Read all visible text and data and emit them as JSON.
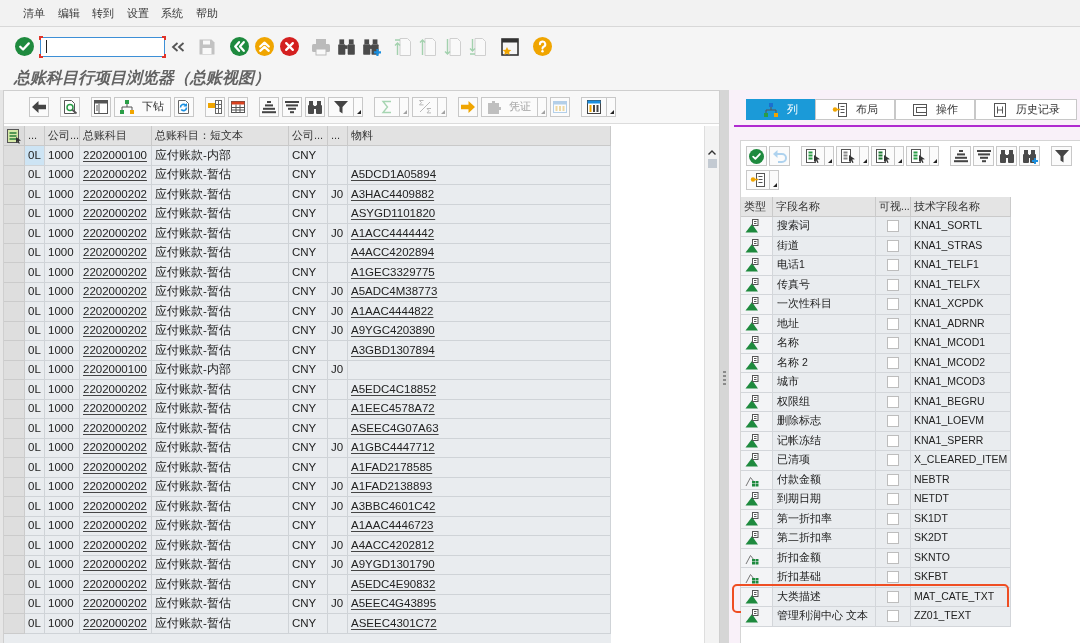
{
  "menu_bar": [
    "清单",
    "编辑",
    "转到",
    "设置",
    "系统",
    "帮助"
  ],
  "toolbar": [
    [
      {
        "kind": "enter",
        "disabled": false
      },
      {
        "kind": "command_field",
        "focused": true
      }
    ],
    [
      {
        "kind": "save",
        "disabled": true
      }
    ],
    [
      {
        "kind": "back",
        "disabled": false
      },
      {
        "kind": "exit",
        "disabled": false
      },
      {
        "kind": "cancel",
        "disabled": false
      }
    ],
    [
      {
        "kind": "print",
        "disabled": true
      },
      {
        "kind": "find",
        "disabled": false
      },
      {
        "kind": "find_next",
        "disabled": false
      }
    ],
    [
      {
        "kind": "first_page",
        "disabled": true
      },
      {
        "kind": "previous_page",
        "disabled": true
      },
      {
        "kind": "next_page",
        "disabled": true
      },
      {
        "kind": "last_page",
        "disabled": true
      }
    ],
    [
      {
        "kind": "new_session",
        "disabled": false
      }
    ],
    [
      {
        "kind": "help",
        "disabled": false
      }
    ]
  ],
  "title": "总账科目行项目浏览器（总账视图）",
  "grid_toolbar": [
    [
      {
        "kind": "back",
        "disabled": false,
        "dropdown": false
      }
    ],
    [
      {
        "kind": "detail",
        "disabled": false,
        "dropdown": false
      }
    ],
    [
      {
        "kind": "list_layout",
        "disabled": false,
        "dropdown": false
      },
      {
        "kind": "drilldown",
        "label": "下钻",
        "disabled": false,
        "dropdown": false
      },
      {
        "kind": "refresh",
        "disabled": false,
        "dropdown": false
      }
    ],
    [
      {
        "kind": "choose_layout",
        "disabled": false,
        "dropdown": false
      },
      {
        "kind": "spreadsheet",
        "disabled": false,
        "dropdown": false
      }
    ],
    [
      {
        "kind": "sort_ascending",
        "disabled": false,
        "dropdown": false
      },
      {
        "kind": "sort_descending",
        "disabled": false,
        "dropdown": false
      },
      {
        "kind": "find",
        "disabled": false,
        "dropdown": false
      },
      {
        "kind": "filter",
        "disabled": false,
        "dropdown": true
      }
    ],
    [
      {
        "kind": "sum",
        "disabled": true,
        "dropdown": true
      },
      {
        "kind": "subtotal",
        "disabled": true,
        "dropdown": true
      }
    ],
    [
      {
        "kind": "next",
        "disabled": false,
        "dropdown": false
      },
      {
        "kind": "document",
        "label": "凭证",
        "disabled": true,
        "dropdown": true
      },
      {
        "kind": "view",
        "disabled": true,
        "dropdown": false
      }
    ],
    [
      {
        "kind": "layout",
        "disabled": false,
        "dropdown": true
      }
    ]
  ],
  "table": {
    "columns": [
      "...",
      "公司...",
      "总账科目",
      "总账科目：短文本",
      "公司...",
      "...",
      "物料"
    ],
    "rows": [
      {
        "column_1": "0L",
        "column_2": "1000",
        "gl_account": "2202000100",
        "gl_short_text": "应付账款-内部",
        "column_5": "CNY",
        "focused": true
      },
      {
        "column_1": "0L",
        "column_2": "1000",
        "gl_account": "2202000202",
        "gl_short_text": "应付账款-暂估",
        "column_5": "CNY",
        "material": "A5DCD1A05894",
        "focused": false
      },
      {
        "column_1": "0L",
        "column_2": "1000",
        "gl_account": "2202000202",
        "gl_short_text": "应付账款-暂估",
        "column_5": "CNY",
        "column_6": "J0",
        "material": "A3HAC4409882",
        "focused": false
      },
      {
        "column_1": "0L",
        "column_2": "1000",
        "gl_account": "2202000202",
        "gl_short_text": "应付账款-暂估",
        "column_5": "CNY",
        "material": "ASYGD1101820",
        "focused": false
      },
      {
        "column_1": "0L",
        "column_2": "1000",
        "gl_account": "2202000202",
        "gl_short_text": "应付账款-暂估",
        "column_5": "CNY",
        "column_6": "J0",
        "material": "A1ACC4444442",
        "focused": false
      },
      {
        "column_1": "0L",
        "column_2": "1000",
        "gl_account": "2202000202",
        "gl_short_text": "应付账款-暂估",
        "column_5": "CNY",
        "material": "A4ACC4202894",
        "focused": false
      },
      {
        "column_1": "0L",
        "column_2": "1000",
        "gl_account": "2202000202",
        "gl_short_text": "应付账款-暂估",
        "column_5": "CNY",
        "material": "A1GEC3329775",
        "focused": false
      },
      {
        "column_1": "0L",
        "column_2": "1000",
        "gl_account": "2202000202",
        "gl_short_text": "应付账款-暂估",
        "column_5": "CNY",
        "column_6": "J0",
        "material": "A5ADC4M38773",
        "focused": false
      },
      {
        "column_1": "0L",
        "column_2": "1000",
        "gl_account": "2202000202",
        "gl_short_text": "应付账款-暂估",
        "column_5": "CNY",
        "column_6": "J0",
        "material": "A1AAC4444822",
        "focused": false
      },
      {
        "column_1": "0L",
        "column_2": "1000",
        "gl_account": "2202000202",
        "gl_short_text": "应付账款-暂估",
        "column_5": "CNY",
        "column_6": "J0",
        "material": "A9YGC4203890",
        "focused": false
      },
      {
        "column_1": "0L",
        "column_2": "1000",
        "gl_account": "2202000202",
        "gl_short_text": "应付账款-暂估",
        "column_5": "CNY",
        "material": "A3GBD1307894",
        "focused": false
      },
      {
        "column_1": "0L",
        "column_2": "1000",
        "gl_account": "2202000100",
        "gl_short_text": "应付账款-内部",
        "column_5": "CNY",
        "column_6": "J0",
        "focused": false
      },
      {
        "column_1": "0L",
        "column_2": "1000",
        "gl_account": "2202000202",
        "gl_short_text": "应付账款-暂估",
        "column_5": "CNY",
        "material": "A5EDC4C18852",
        "focused": false
      },
      {
        "column_1": "0L",
        "column_2": "1000",
        "gl_account": "2202000202",
        "gl_short_text": "应付账款-暂估",
        "column_5": "CNY",
        "material": "A1EEC4578A72",
        "focused": false
      },
      {
        "column_1": "0L",
        "column_2": "1000",
        "gl_account": "2202000202",
        "gl_short_text": "应付账款-暂估",
        "column_5": "CNY",
        "material": "ASEEC4G07A63",
        "focused": false
      },
      {
        "column_1": "0L",
        "column_2": "1000",
        "gl_account": "2202000202",
        "gl_short_text": "应付账款-暂估",
        "column_5": "CNY",
        "column_6": "J0",
        "material": "A1GBC4447712",
        "focused": false
      },
      {
        "column_1": "0L",
        "column_2": "1000",
        "gl_account": "2202000202",
        "gl_short_text": "应付账款-暂估",
        "column_5": "CNY",
        "material": "A1FAD2178585",
        "focused": false
      },
      {
        "column_1": "0L",
        "column_2": "1000",
        "gl_account": "2202000202",
        "gl_short_text": "应付账款-暂估",
        "column_5": "CNY",
        "column_6": "J0",
        "material": "A1FAD2138893",
        "focused": false
      },
      {
        "column_1": "0L",
        "column_2": "1000",
        "gl_account": "2202000202",
        "gl_short_text": "应付账款-暂估",
        "column_5": "CNY",
        "column_6": "J0",
        "material": "A3BBC4601C42",
        "focused": false
      },
      {
        "column_1": "0L",
        "column_2": "1000",
        "gl_account": "2202000202",
        "gl_short_text": "应付账款-暂估",
        "column_5": "CNY",
        "material": "A1AAC4446723",
        "focused": false
      },
      {
        "column_1": "0L",
        "column_2": "1000",
        "gl_account": "2202000202",
        "gl_short_text": "应付账款-暂估",
        "column_5": "CNY",
        "column_6": "J0",
        "material": "A4ACC4202812",
        "focused": false
      },
      {
        "column_1": "0L",
        "column_2": "1000",
        "gl_account": "2202000202",
        "gl_short_text": "应付账款-暂估",
        "column_5": "CNY",
        "column_6": "J0",
        "material": "A9YGD1301790",
        "focused": false
      },
      {
        "column_1": "0L",
        "column_2": "1000",
        "gl_account": "2202000202",
        "gl_short_text": "应付账款-暂估",
        "column_5": "CNY",
        "material": "A5EDC4E90832",
        "focused": false
      },
      {
        "column_1": "0L",
        "column_2": "1000",
        "gl_account": "2202000202",
        "gl_short_text": "应付账款-暂估",
        "column_5": "CNY",
        "column_6": "J0",
        "material": "A5EEC4G43895",
        "focused": false
      },
      {
        "column_1": "0L",
        "column_2": "1000",
        "gl_account": "2202000202",
        "gl_short_text": "应付账款-暂估",
        "column_5": "CNY",
        "material": "ASEEC4301C72",
        "focused": false
      }
    ]
  },
  "side_panel": {
    "tabs": [
      {
        "kind": "columns",
        "label": "列",
        "selected": true
      },
      {
        "kind": "layout",
        "label": "布局",
        "selected": false
      },
      {
        "kind": "operations",
        "label": "操作",
        "selected": false
      },
      {
        "kind": "history",
        "label": "历史记录",
        "selected": false
      }
    ],
    "toolbar": [
      [
        [
          {
            "kind": "confirm",
            "disabled": false,
            "dropdown": false
          },
          {
            "kind": "undo",
            "disabled": true,
            "dropdown": false
          }
        ],
        [
          {
            "kind": "show_column",
            "disabled": false,
            "dropdown": true
          },
          {
            "kind": "hide_column",
            "disabled": false,
            "dropdown": true
          },
          {
            "kind": "mark_column",
            "disabled": false,
            "dropdown": true
          },
          {
            "kind": "move_column",
            "disabled": false,
            "dropdown": true
          }
        ],
        [
          {
            "kind": "sort_ascending",
            "disabled": false,
            "dropdown": false
          },
          {
            "kind": "sort_descending",
            "disabled": false,
            "dropdown": false
          },
          {
            "kind": "find",
            "disabled": false,
            "dropdown": false
          },
          {
            "kind": "find_next",
            "disabled": false,
            "dropdown": false
          }
        ],
        [
          {
            "kind": "filter",
            "disabled": false,
            "dropdown": false
          }
        ]
      ],
      [
        [
          {
            "kind": "layout_key",
            "disabled": false,
            "dropdown": true
          }
        ]
      ]
    ],
    "field_table": {
      "columns": [
        "类型",
        "字段名称",
        "可视...",
        "技术字段名称"
      ],
      "rows": [
        {
          "kind": "character",
          "name": "搜索词",
          "checked": false,
          "technical_name": "KNA1_SORTL",
          "highlighted": false
        },
        {
          "kind": "character",
          "name": "街道",
          "checked": false,
          "technical_name": "KNA1_STRAS",
          "highlighted": false
        },
        {
          "kind": "character",
          "name": "电话1",
          "checked": false,
          "technical_name": "KNA1_TELF1",
          "highlighted": false
        },
        {
          "kind": "character",
          "name": "传真号",
          "checked": false,
          "technical_name": "KNA1_TELFX",
          "highlighted": false
        },
        {
          "kind": "character",
          "name": "一次性科目",
          "checked": false,
          "technical_name": "KNA1_XCPDK",
          "highlighted": false
        },
        {
          "kind": "character",
          "name": "地址",
          "checked": false,
          "technical_name": "KNA1_ADRNR",
          "highlighted": false
        },
        {
          "kind": "character",
          "name": "名称",
          "checked": false,
          "technical_name": "KNA1_MCOD1",
          "highlighted": false
        },
        {
          "kind": "character",
          "name": "名称 2",
          "checked": false,
          "technical_name": "KNA1_MCOD2",
          "highlighted": false
        },
        {
          "kind": "character",
          "name": "城市",
          "checked": false,
          "technical_name": "KNA1_MCOD3",
          "highlighted": false
        },
        {
          "kind": "character",
          "name": "权限组",
          "checked": false,
          "technical_name": "KNA1_BEGRU",
          "highlighted": false
        },
        {
          "kind": "character",
          "name": "删除标志",
          "checked": false,
          "technical_name": "KNA1_LOEVM",
          "highlighted": false
        },
        {
          "kind": "character",
          "name": "记帐冻结",
          "checked": false,
          "technical_name": "KNA1_SPERR",
          "highlighted": false
        },
        {
          "kind": "character",
          "name": "已清项",
          "checked": false,
          "technical_name": "X_CLEARED_ITEM",
          "highlighted": false
        },
        {
          "kind": "amount",
          "name": "付款金额",
          "checked": false,
          "technical_name": "NEBTR",
          "highlighted": false
        },
        {
          "kind": "character",
          "name": "到期日期",
          "checked": false,
          "technical_name": "NETDT",
          "highlighted": false
        },
        {
          "kind": "character",
          "name": "第一折扣率",
          "checked": false,
          "technical_name": "SK1DT",
          "highlighted": false
        },
        {
          "kind": "character",
          "name": "第二折扣率",
          "checked": false,
          "technical_name": "SK2DT",
          "highlighted": false
        },
        {
          "kind": "amount",
          "name": "折扣金额",
          "checked": false,
          "technical_name": "SKNTO",
          "highlighted": false
        },
        {
          "kind": "amount",
          "name": "折扣基础",
          "checked": false,
          "technical_name": "SKFBT",
          "highlighted": false
        },
        {
          "kind": "character",
          "name": "大类描述",
          "checked": false,
          "technical_name": "MAT_CATE_TXT",
          "highlighted": true
        },
        {
          "kind": "character",
          "name": "管理利润中心 文本",
          "checked": false,
          "technical_name": "ZZ01_TEXT",
          "highlighted": false
        }
      ]
    }
  }
}
